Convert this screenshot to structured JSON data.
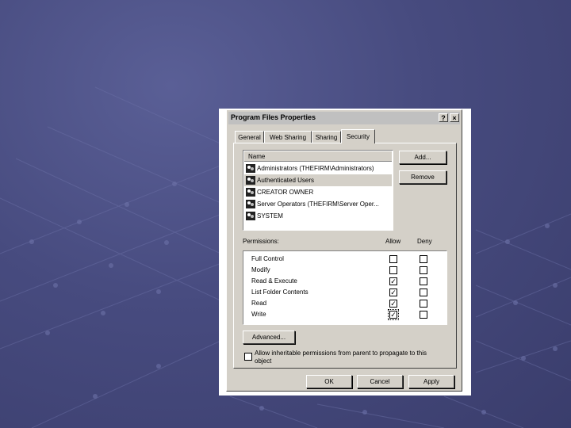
{
  "dialog": {
    "title": "Program Files Properties",
    "help_btn": "?",
    "close_btn": "×"
  },
  "tabs": [
    {
      "label": "General",
      "active": false
    },
    {
      "label": "Web Sharing",
      "active": false
    },
    {
      "label": "Sharing",
      "active": false
    },
    {
      "label": "Security",
      "active": true
    }
  ],
  "users": {
    "header": "Name",
    "items": [
      {
        "name": "Administrators (THEFIRM\\Administrators)",
        "selected": false
      },
      {
        "name": "Authenticated Users",
        "selected": true
      },
      {
        "name": "CREATOR OWNER",
        "selected": false
      },
      {
        "name": "Server Operators (THEFIRM\\Server Oper...",
        "selected": false
      },
      {
        "name": "SYSTEM",
        "selected": false
      }
    ]
  },
  "buttons": {
    "add": "Add...",
    "remove": "Remove",
    "advanced": "Advanced...",
    "ok": "OK",
    "cancel": "Cancel",
    "apply": "Apply"
  },
  "permissions": {
    "label": "Permissions:",
    "allow_header": "Allow",
    "deny_header": "Deny",
    "items": [
      {
        "name": "Full Control",
        "allow": false,
        "deny": false
      },
      {
        "name": "Modify",
        "allow": false,
        "deny": false
      },
      {
        "name": "Read & Execute",
        "allow": true,
        "deny": false
      },
      {
        "name": "List Folder Contents",
        "allow": true,
        "deny": false
      },
      {
        "name": "Read",
        "allow": true,
        "deny": false
      },
      {
        "name": "Write",
        "allow": true,
        "deny": false
      }
    ]
  },
  "inherit": {
    "text": "Allow inheritable permissions from parent to propagate to this object",
    "checked": false
  },
  "colors": {
    "desktop": "#474b7f",
    "dialog": "#d4d0c8"
  }
}
